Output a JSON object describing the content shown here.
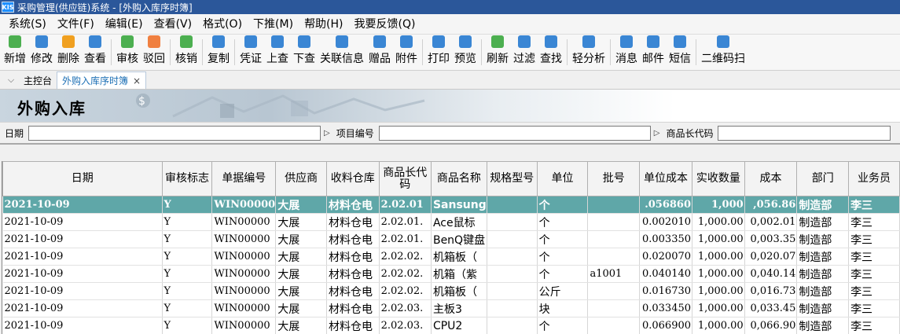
{
  "window": {
    "logo": "KIS",
    "title": "采购管理(供应链)系统 - [外购入库序时簿]"
  },
  "menu": [
    "系统(S)",
    "文件(F)",
    "编辑(E)",
    "查看(V)",
    "格式(O)",
    "下推(M)",
    "帮助(H)",
    "我要反馈(Q)"
  ],
  "toolbar": [
    {
      "label": "新增",
      "icon": "add-icon",
      "color": "#4caf50"
    },
    {
      "label": "修改",
      "icon": "edit-icon",
      "color": "#3a86d4"
    },
    {
      "label": "删除",
      "icon": "trash-icon",
      "color": "#f0a020"
    },
    {
      "label": "查看",
      "icon": "view-icon",
      "color": "#3a86d4"
    },
    {
      "sep": true
    },
    {
      "label": "审核",
      "icon": "audit-icon",
      "color": "#4caf50"
    },
    {
      "label": "驳回",
      "icon": "reject-icon",
      "color": "#f08040"
    },
    {
      "sep": true
    },
    {
      "label": "核销",
      "icon": "verify-icon",
      "color": "#4caf50"
    },
    {
      "sep": true
    },
    {
      "label": "复制",
      "icon": "copy-icon",
      "color": "#3a86d4"
    },
    {
      "sep": true
    },
    {
      "label": "凭证",
      "icon": "voucher-icon",
      "color": "#3a86d4"
    },
    {
      "label": "上查",
      "icon": "search-up-icon",
      "color": "#3a86d4"
    },
    {
      "label": "下查",
      "icon": "search-down-icon",
      "color": "#3a86d4"
    },
    {
      "label": "关联信息",
      "icon": "link-icon",
      "color": "#3a86d4"
    },
    {
      "label": "赠品",
      "icon": "gift-icon",
      "color": "#3a86d4"
    },
    {
      "label": "附件",
      "icon": "attach-icon",
      "color": "#3a86d4"
    },
    {
      "sep": true
    },
    {
      "label": "打印",
      "icon": "print-icon",
      "color": "#3a86d4"
    },
    {
      "label": "预览",
      "icon": "preview-icon",
      "color": "#3a86d4"
    },
    {
      "sep": true
    },
    {
      "label": "刷新",
      "icon": "refresh-icon",
      "color": "#4caf50"
    },
    {
      "label": "过滤",
      "icon": "filter-icon",
      "color": "#3a86d4"
    },
    {
      "label": "查找",
      "icon": "find-icon",
      "color": "#3a86d4"
    },
    {
      "sep": true
    },
    {
      "label": "轻分析",
      "icon": "analysis-icon",
      "color": "#3a86d4"
    },
    {
      "sep": true
    },
    {
      "label": "消息",
      "icon": "message-icon",
      "color": "#3a86d4"
    },
    {
      "label": "邮件",
      "icon": "mail-icon",
      "color": "#3a86d4"
    },
    {
      "label": "短信",
      "icon": "sms-icon",
      "color": "#3a86d4"
    },
    {
      "sep": true
    },
    {
      "label": "二维码扫",
      "icon": "qrcode-icon",
      "color": "#3a86d4"
    }
  ],
  "tabs": [
    {
      "label": "主控台",
      "active": false
    },
    {
      "label": "外购入库序时簿",
      "active": true,
      "close": "×"
    }
  ],
  "banner": {
    "title": "外购入库"
  },
  "filter": {
    "date_label": "日期",
    "item_label": "项目编号",
    "code_label": "商品长代码"
  },
  "table": {
    "columns": [
      "日期",
      "审核标志",
      "单据编号",
      "供应商",
      "收料仓库",
      "商品长代码",
      "商品名称",
      "规格型号",
      "单位",
      "批号",
      "单位成本",
      "实收数量",
      "成本",
      "部门",
      "业务员"
    ],
    "rows": [
      [
        "2021-10-09",
        "Y",
        "WIN00000",
        "大展",
        "材料仓电",
        "2.02.01",
        "Sansung",
        "",
        "个",
        "",
        ".056860",
        "1,000",
        ",056.86",
        "制造部",
        "李三"
      ],
      [
        "2021-10-09",
        "Y",
        "WIN00000",
        "大展",
        "材料仓电",
        "2.02.01.",
        "Ace鼠标",
        "",
        "个",
        "",
        "0.002010",
        "1,000.00",
        "0,002.01",
        "制造部",
        "李三"
      ],
      [
        "2021-10-09",
        "Y",
        "WIN00000",
        "大展",
        "材料仓电",
        "2.02.01.",
        "BenQ键盘",
        "",
        "个",
        "",
        "0.003350",
        "1,000.00",
        "0,003.35",
        "制造部",
        "李三"
      ],
      [
        "2021-10-09",
        "Y",
        "WIN00000",
        "大展",
        "材料仓电",
        "2.02.02.",
        "机箱板（",
        "",
        "个",
        "",
        "0.020070",
        "1,000.00",
        "0,020.07",
        "制造部",
        "李三"
      ],
      [
        "2021-10-09",
        "Y",
        "WIN00000",
        "大展",
        "材料仓电",
        "2.02.02.",
        "机箱（紫",
        "",
        "个",
        "a1001",
        "0.040140",
        "1,000.00",
        "0,040.14",
        "制造部",
        "李三"
      ],
      [
        "2021-10-09",
        "Y",
        "WIN00000",
        "大展",
        "材料仓电",
        "2.02.02.",
        "机箱板（",
        "",
        "公斤",
        "",
        "0.016730",
        "1,000.00",
        "0,016.73",
        "制造部",
        "李三"
      ],
      [
        "2021-10-09",
        "Y",
        "WIN00000",
        "大展",
        "材料仓电",
        "2.02.03.",
        "主板3",
        "",
        "块",
        "",
        "0.033450",
        "1,000.00",
        "0,033.45",
        "制造部",
        "李三"
      ],
      [
        "2021-10-09",
        "Y",
        "WIN00000",
        "大展",
        "材料仓电",
        "2.02.03.",
        "CPU2",
        "",
        "个",
        "",
        "0.066900",
        "1,000.00",
        "0,066.90",
        "制造部",
        "李三"
      ]
    ]
  }
}
